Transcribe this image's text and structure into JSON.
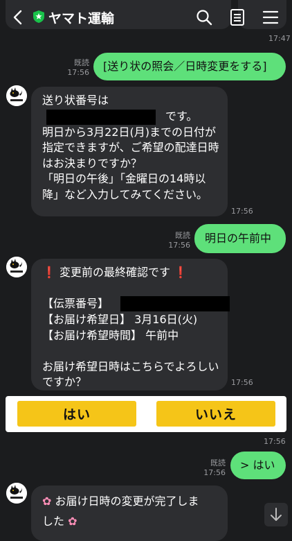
{
  "header": {
    "title": "ヤマト運輸"
  },
  "messages": {
    "t1": "17:47",
    "m1_read": "既読",
    "m1_time": "17:56",
    "m1_text": "[送り状の照会／日時変更をする]",
    "m2_line1": "送り状番号は",
    "m2_line2": "です。",
    "m2_rest": "明日から3月22日(月)までの日付が指定できますが、ご希望の配達日時はお決まりですか？\n「明日の午後」「金曜日の14時以降」など入力してみてください。",
    "m2_time": "17:56",
    "m3_read": "既読",
    "m3_time": "17:56",
    "m3_text": "明日の午前中",
    "m4_title": "変更前の最終確認です",
    "m4_label1": "【伝票番号】",
    "m4_line2": "【お届け希望日】 3月16日(火)",
    "m4_line3": "【お届け希望時間】 午前中",
    "m4_question": "お届け希望日時はこちらでよろしいですか？",
    "m4_time": "17:56",
    "quick_time": "17:56",
    "m5_read": "既読",
    "m5_time": "17:56",
    "m5_text": "> はい",
    "m6_text_a": "お届け日時の変更が完了しま",
    "m6_text_b": "した"
  },
  "quick_replies": {
    "yes": "はい",
    "no": "いいえ"
  },
  "icons": [
    "back-icon",
    "shield-icon",
    "search-icon",
    "notes-icon",
    "menu-icon",
    "avatar-cat-icon",
    "exclamation-icon",
    "flower-icon",
    "scroll-down-icon"
  ],
  "colors": {
    "background": "#1b1c1e",
    "outgoing_bubble": "#5ee07a",
    "incoming_bubble": "#2d2e31",
    "quick_reply_button": "#f5c518",
    "shield_green": "#19c24a",
    "alert_red": "#e8262c"
  }
}
